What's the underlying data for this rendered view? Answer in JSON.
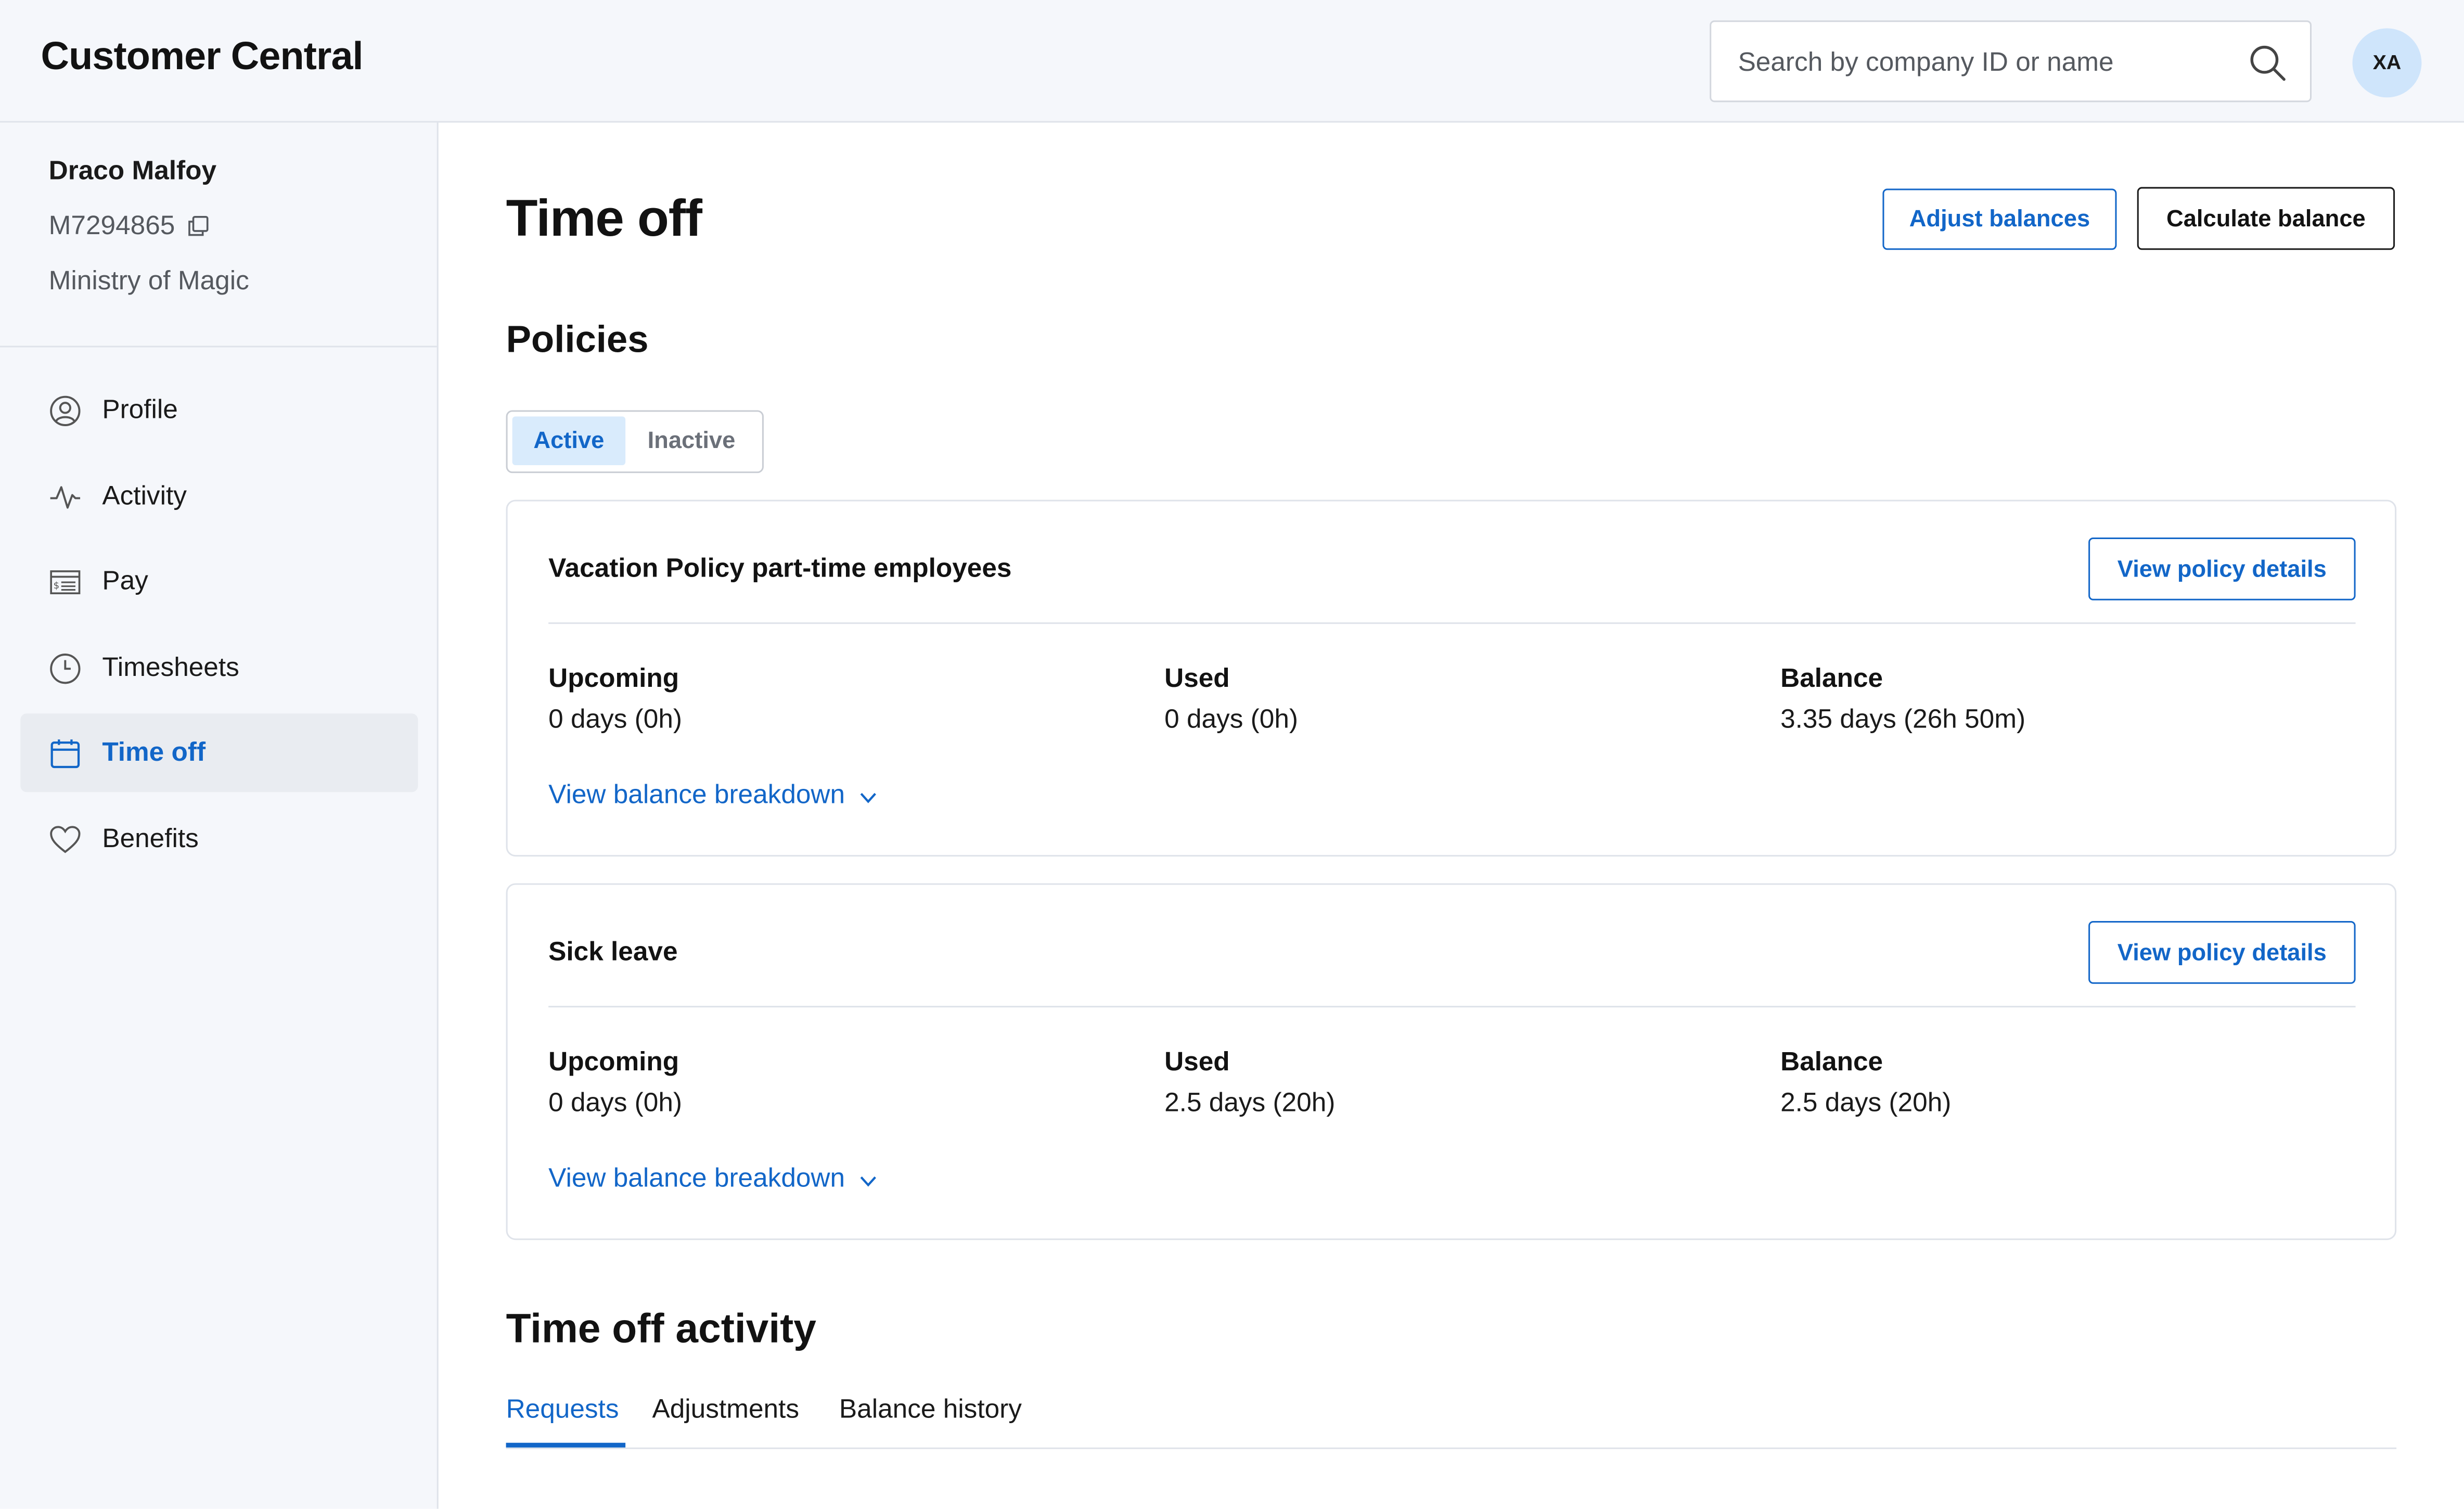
{
  "app": {
    "title": "Customer Central"
  },
  "search": {
    "placeholder": "Search by company ID or name",
    "value": "",
    "icon": "search-icon"
  },
  "user_menu": {
    "initials": "XA"
  },
  "employee": {
    "name": "Draco Malfoy",
    "id": "M7294865",
    "organization": "Ministry of Magic"
  },
  "sidebar": {
    "items": [
      {
        "label": "Profile",
        "icon": "user-circle-icon",
        "active": false
      },
      {
        "label": "Activity",
        "icon": "activity-pulse-icon",
        "active": false
      },
      {
        "label": "Pay",
        "icon": "pay-stub-icon",
        "active": false
      },
      {
        "label": "Timesheets",
        "icon": "clock-icon",
        "active": false
      },
      {
        "label": "Time off",
        "icon": "calendar-icon",
        "active": true
      },
      {
        "label": "Benefits",
        "icon": "heart-icon",
        "active": false
      }
    ]
  },
  "page": {
    "title": "Time off",
    "adjust_balances_label": "Adjust balances",
    "calculate_balance_label": "Calculate balance"
  },
  "policies": {
    "title": "Policies",
    "filter": {
      "active_label": "Active",
      "inactive_label": "Inactive",
      "selected": "Active"
    },
    "items": [
      {
        "name": "Vacation Policy part-time employees",
        "view_details_label": "View policy details",
        "upcoming_label": "Upcoming",
        "upcoming_value": "0 days (0h)",
        "used_label": "Used",
        "used_value": "0 days (0h)",
        "balance_label": "Balance",
        "balance_value": "3.35 days (26h 50m)",
        "breakdown_label": "View balance breakdown"
      },
      {
        "name": "Sick leave",
        "view_details_label": "View policy details",
        "upcoming_label": "Upcoming",
        "upcoming_value": "0 days (0h)",
        "used_label": "Used",
        "used_value": "2.5 days (20h)",
        "balance_label": "Balance",
        "balance_value": "2.5 days (20h)",
        "breakdown_label": "View balance breakdown"
      }
    ]
  },
  "activity": {
    "title": "Time off activity",
    "tabs": [
      {
        "label": "Requests",
        "active": true
      },
      {
        "label": "Adjustments",
        "active": false
      },
      {
        "label": "Balance history",
        "active": false
      }
    ]
  },
  "colors": {
    "accent": "#1266c8",
    "accent_light": "#d9ebfc",
    "sidebar_bg": "#f5f7fb",
    "border": "#dfe3ea",
    "avatar_bg": "#cfe5fb"
  }
}
